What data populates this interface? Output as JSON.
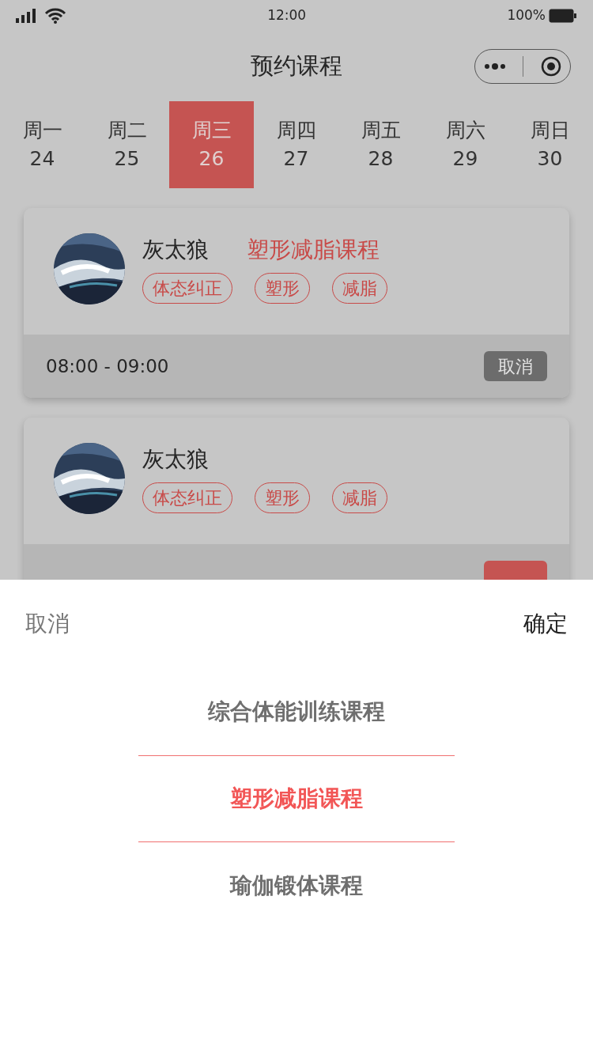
{
  "status_bar": {
    "time": "12:00",
    "battery": "100%"
  },
  "nav": {
    "title": "预约课程"
  },
  "days": [
    {
      "weekday": "周一",
      "date": "24",
      "selected": false
    },
    {
      "weekday": "周二",
      "date": "25",
      "selected": false
    },
    {
      "weekday": "周三",
      "date": "26",
      "selected": true
    },
    {
      "weekday": "周四",
      "date": "27",
      "selected": false
    },
    {
      "weekday": "周五",
      "date": "28",
      "selected": false
    },
    {
      "weekday": "周六",
      "date": "29",
      "selected": false
    },
    {
      "weekday": "周日",
      "date": "30",
      "selected": false
    }
  ],
  "courses": [
    {
      "coach": "灰太狼",
      "course": "塑形减脂课程",
      "tags": [
        "体态纠正",
        "塑形",
        "减脂"
      ],
      "time": "08:00 - 09:00",
      "action": {
        "kind": "cancel",
        "label": "取消"
      }
    },
    {
      "coach": "灰太狼",
      "tags": [
        "体态纠正",
        "塑形",
        "减脂"
      ],
      "action": {
        "kind": "book"
      }
    }
  ],
  "picker": {
    "cancel": "取消",
    "confirm": "确定",
    "options": [
      {
        "label": "综合体能训练课程",
        "selected": false
      },
      {
        "label": "塑形减脂课程",
        "selected": true
      },
      {
        "label": "瑜伽锻体课程",
        "selected": false
      }
    ]
  }
}
